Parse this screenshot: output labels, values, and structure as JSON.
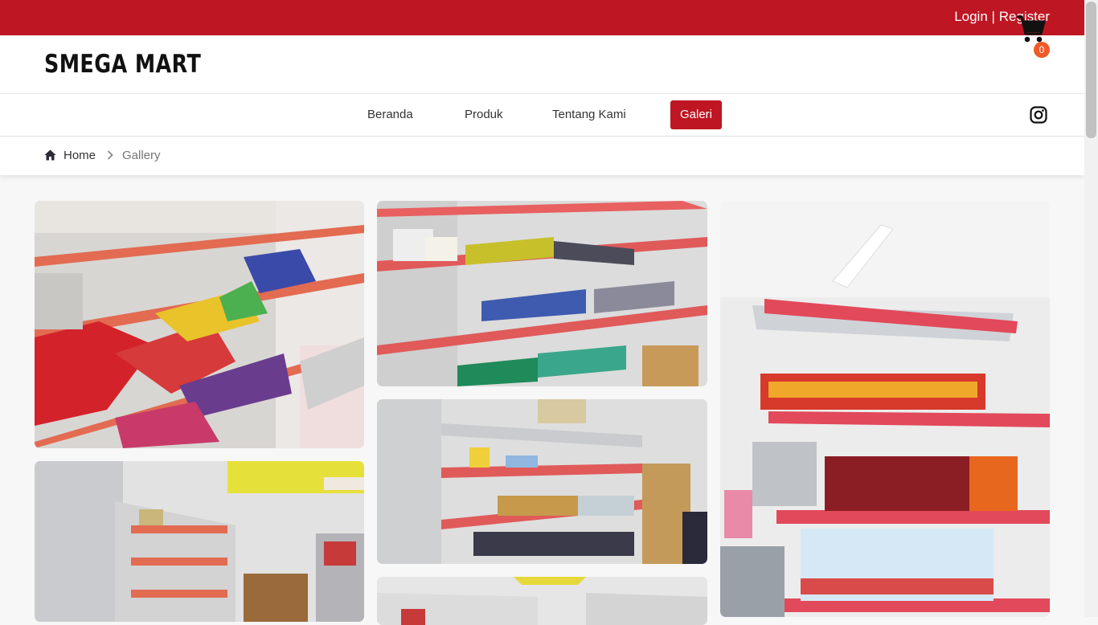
{
  "topbar": {
    "login_label": "Login",
    "separator": "|",
    "register_label": "Register",
    "color": "#be1622"
  },
  "header": {
    "brand": "SMEGA MART",
    "cart_count": "0",
    "cart_icon": "shopping-cart-icon"
  },
  "nav": {
    "items": [
      {
        "label": "Beranda"
      },
      {
        "label": "Produk"
      },
      {
        "label": "Tentang Kami"
      },
      {
        "label": "Galeri",
        "active": true
      }
    ],
    "social_icon": "instagram-icon"
  },
  "breadcrumb": {
    "home_label": "Home",
    "current_label": "Gallery"
  },
  "gallery": {
    "images": [
      {
        "alt": "Snack shelves"
      },
      {
        "alt": "Stationery shelves"
      },
      {
        "alt": "Beverage shelves"
      },
      {
        "alt": "Store corner shelves"
      },
      {
        "alt": "Office supplies shelves"
      },
      {
        "alt": "Store ceiling view"
      }
    ]
  }
}
